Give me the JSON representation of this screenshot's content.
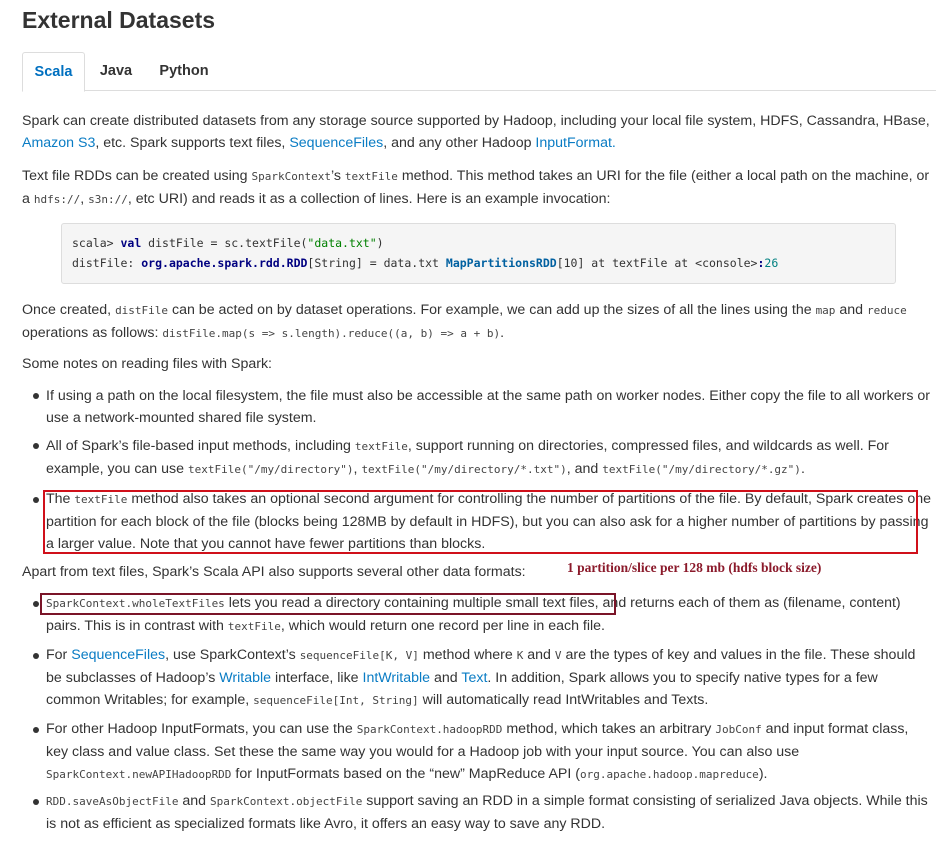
{
  "page": {
    "title": "External Datasets"
  },
  "tabs": [
    {
      "label": "Scala",
      "active": true
    },
    {
      "label": "Java",
      "active": false
    },
    {
      "label": "Python",
      "active": false
    }
  ],
  "intro": {
    "text1": "Spark can create distributed datasets from any storage source supported by Hadoop, including your local file system, HDFS, Cassandra, HBase, ",
    "link_s3": "Amazon S3",
    "text2": ", etc. Spark supports text files, ",
    "link_seq": "SequenceFiles",
    "text3": ", and any other Hadoop ",
    "link_input": "InputFormat",
    "text4": "."
  },
  "textfile_para": {
    "t1": "Text file RDDs can be created using ",
    "c1": "SparkContext",
    "t2": "’s ",
    "c2": "textFile",
    "t3": " method. This method takes an URI for the file (either a local path on the machine, or a ",
    "c3": "hdfs://",
    "t4": ", ",
    "c4": "s3n://",
    "t5": ", etc URI) and reads it as a collection of lines. Here is an example invocation:"
  },
  "code": {
    "l1_prompt": "scala> ",
    "l1_kw": "val",
    "l1_mid": " distFile = sc.textFile(",
    "l1_str": "\"data.txt\"",
    "l1_end": ")",
    "l2_a": "distFile: ",
    "l2_type": "org.apache.spark.rdd.RDD",
    "l2_b": "[String] = data.txt ",
    "l2_cls": "MapPartitionsRDD",
    "l2_c": "[10] at textFile at <console>",
    "l2_colon": ":",
    "l2_num": "26"
  },
  "once_para": {
    "t1": "Once created, ",
    "c1": "distFile",
    "t2": " can be acted on by dataset operations. For example, we can add up the sizes of all the lines using the ",
    "c2": "map",
    "t3": " and ",
    "c3": "reduce",
    "t4": " operations as follows: ",
    "c4": "distFile.map(s => s.length).reduce((a, b) => a + b)",
    "t5": "."
  },
  "notes_heading": "Some notes on reading files with Spark:",
  "notes": {
    "n1": "If using a path on the local filesystem, the file must also be accessible at the same path on worker nodes. Either copy the file to all workers or use a network-mounted shared file system.",
    "n2_t1": "All of Spark’s file-based input methods, including ",
    "n2_c1": "textFile",
    "n2_t2": ", support running on directories, compressed files, and wildcards as well. For example, you can use ",
    "n2_c2": "textFile(\"/my/directory\")",
    "n2_t3": ", ",
    "n2_c3": "textFile(\"/my/directory/*.txt\")",
    "n2_t4": ", and ",
    "n2_c4": "textFile(\"/my/directory/*.gz\")",
    "n2_t5": ".",
    "n3_t1": "The ",
    "n3_c1": "textFile",
    "n3_t2": " method also takes an optional second argument for controlling the number of partitions of the file. By default, Spark creates one partition for each block of the file (blocks being 128MB by default in HDFS), but you can also ask for a higher number of partitions by passing a larger value. Note that you cannot have fewer partitions than blocks."
  },
  "annotation": "1 partition/slice per 128 mb (hdfs block size)",
  "apart_para": "Apart from text files, Spark’s Scala API also supports several other data formats:",
  "formats": {
    "f1_c1": "SparkContext.wholeTextFiles",
    "f1_t1": " lets you read a directory containing multiple small text files",
    "f1_t2": ", and returns each of them as (filename, content) pairs. This is in contrast with ",
    "f1_c2": "textFile",
    "f1_t3": ", which would return one record per line in each file.",
    "f2_t1": "For ",
    "f2_l1": "SequenceFiles",
    "f2_t2": ", use SparkContext’s ",
    "f2_c1": "sequenceFile[K, V]",
    "f2_t3": " method where ",
    "f2_c2": "K",
    "f2_t4": " and ",
    "f2_c3": "V",
    "f2_t5": " are the types of key and values in the file. These should be subclasses of Hadoop’s ",
    "f2_l2": "Writable",
    "f2_t6": " interface, like ",
    "f2_l3": "IntWritable",
    "f2_t7": " and ",
    "f2_l4": "Text",
    "f2_t8": ". In addition, Spark allows you to specify native types for a few common Writables; for example, ",
    "f2_c4": "sequenceFile[Int, String]",
    "f2_t9": " will automatically read IntWritables and Texts.",
    "f3_t1": "For other Hadoop InputFormats, you can use the ",
    "f3_c1": "SparkContext.hadoopRDD",
    "f3_t2": " method, which takes an arbitrary ",
    "f3_c2": "JobConf",
    "f3_t3": " and input format class, key class and value class. Set these the same way you would for a Hadoop job with your input source. You can also use ",
    "f3_c3": "SparkContext.newAPIHadoopRDD",
    "f3_t4": " for InputFormats based on the “new” MapReduce API (",
    "f3_c4": "org.apache.hadoop.mapreduce",
    "f3_t5": ").",
    "f4_c1": "RDD.saveAsObjectFile",
    "f4_t1": " and ",
    "f4_c2": "SparkContext.objectFile",
    "f4_t2": " support saving an RDD in a simple format consisting of serialized Java objects. While this is not as efficient as specialized formats like Avro, it offers an easy way to save any RDD."
  },
  "colors": {
    "link": "#0a7cc4",
    "highlight_red": "#d0101a",
    "highlight_dark": "#7a1428",
    "annotation": "#8b1a2b"
  }
}
